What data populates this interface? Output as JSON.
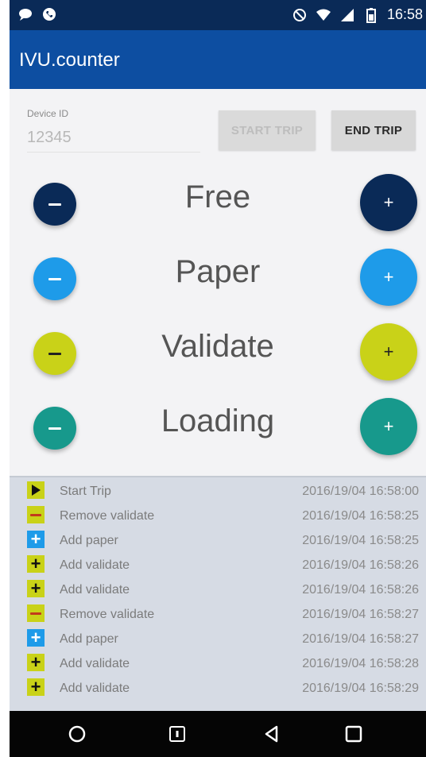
{
  "statusbar": {
    "time": "16:58"
  },
  "app": {
    "title": "IVU.counter"
  },
  "device": {
    "label": "Device ID",
    "value": "12345"
  },
  "buttons": {
    "start_trip": "START TRIP",
    "end_trip": "END TRIP"
  },
  "counters": [
    {
      "label": "Free",
      "color": "#0a2a57"
    },
    {
      "label": "Paper",
      "color": "#1e9be9"
    },
    {
      "label": "Validate",
      "color": "#c9d218"
    },
    {
      "label": "Loading",
      "color": "#17998c"
    }
  ],
  "log": [
    {
      "icon": "play-icon",
      "label": "Start Trip",
      "time": "2016/19/04 16:58:00"
    },
    {
      "icon": "minus-icon",
      "label": "Remove validate",
      "time": "2016/19/04 16:58:25"
    },
    {
      "icon": "plus-blue-icon",
      "label": "Add paper",
      "time": "2016/19/04 16:58:25"
    },
    {
      "icon": "plus-yellow-icon",
      "label": "Add validate",
      "time": "2016/19/04 16:58:26"
    },
    {
      "icon": "plus-yellow-icon",
      "label": "Add validate",
      "time": "2016/19/04 16:58:26"
    },
    {
      "icon": "minus-icon",
      "label": "Remove validate",
      "time": "2016/19/04 16:58:27"
    },
    {
      "icon": "plus-blue-icon",
      "label": "Add paper",
      "time": "2016/19/04 16:58:27"
    },
    {
      "icon": "plus-yellow-icon",
      "label": "Add validate",
      "time": "2016/19/04 16:58:28"
    },
    {
      "icon": "plus-yellow-icon",
      "label": "Add validate",
      "time": "2016/19/04 16:58:29"
    }
  ]
}
